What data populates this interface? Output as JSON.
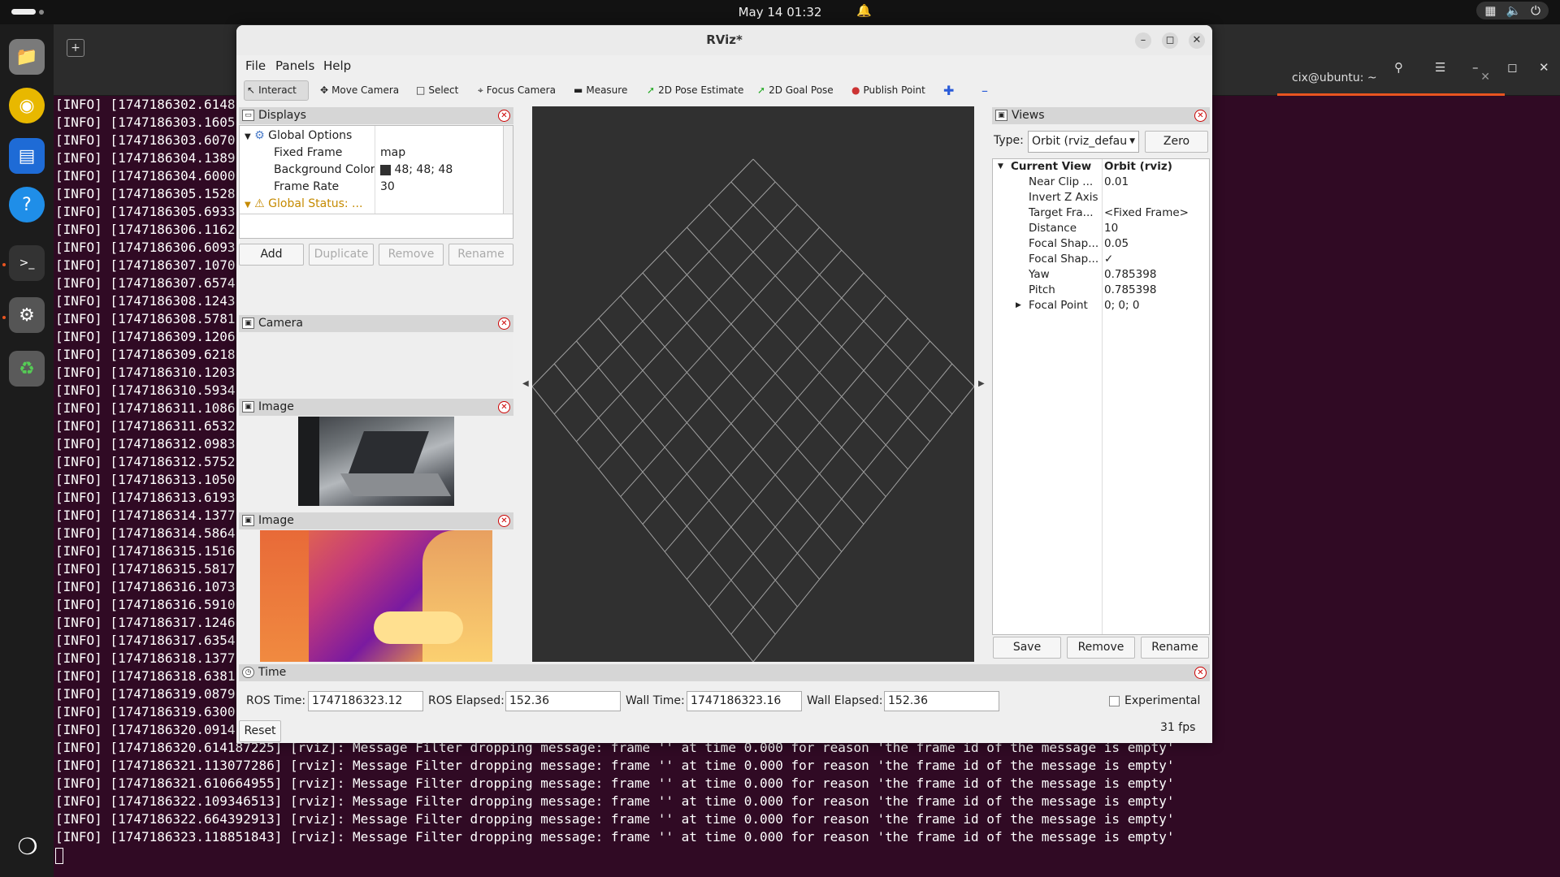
{
  "desktop": {
    "clock": "May 14  01:32"
  },
  "terminal": {
    "tab_title": "cix@ubuntu: ~",
    "lines": [
      "[INFO] [1747186302.6148",
      "[INFO] [1747186303.1605",
      "[INFO] [1747186303.6070",
      "[INFO] [1747186304.1389",
      "[INFO] [1747186304.6000",
      "[INFO] [1747186305.1528",
      "[INFO] [1747186305.6933",
      "[INFO] [1747186306.1162",
      "[INFO] [1747186306.6093",
      "[INFO] [1747186307.1070",
      "[INFO] [1747186307.6574",
      "[INFO] [1747186308.1243",
      "[INFO] [1747186308.5781",
      "[INFO] [1747186309.1206",
      "[INFO] [1747186309.6218",
      "[INFO] [1747186310.1203",
      "[INFO] [1747186310.5934",
      "[INFO] [1747186311.1086",
      "[INFO] [1747186311.6532",
      "[INFO] [1747186312.0983",
      "[INFO] [1747186312.5752",
      "[INFO] [1747186313.1050",
      "[INFO] [1747186313.6193",
      "[INFO] [1747186314.1377",
      "[INFO] [1747186314.5864",
      "[INFO] [1747186315.1516",
      "[INFO] [1747186315.5817",
      "[INFO] [1747186316.1073",
      "[INFO] [1747186316.5910",
      "[INFO] [1747186317.1246",
      "[INFO] [1747186317.6354",
      "[INFO] [1747186318.1377",
      "[INFO] [1747186318.6381",
      "[INFO] [1747186319.0879",
      "[INFO] [1747186319.6300",
      "[INFO] [1747186320.0914",
      "[INFO] [1747186320.614187225] [rviz]: Message Filter dropping message: frame '' at time 0.000 for reason 'the frame id of the message is empty'",
      "[INFO] [1747186321.113077286] [rviz]: Message Filter dropping message: frame '' at time 0.000 for reason 'the frame id of the message is empty'",
      "[INFO] [1747186321.610664955] [rviz]: Message Filter dropping message: frame '' at time 0.000 for reason 'the frame id of the message is empty'",
      "[INFO] [1747186322.109346513] [rviz]: Message Filter dropping message: frame '' at time 0.000 for reason 'the frame id of the message is empty'",
      "[INFO] [1747186322.664392913] [rviz]: Message Filter dropping message: frame '' at time 0.000 for reason 'the frame id of the message is empty'",
      "[INFO] [1747186323.118851843] [rviz]: Message Filter dropping message: frame '' at time 0.000 for reason 'the frame id of the message is empty'"
    ]
  },
  "rviz": {
    "title": "RViz*",
    "menu": {
      "file": "File",
      "panels": "Panels",
      "help": "Help"
    },
    "toolbar": {
      "interact": "Interact",
      "move_camera": "Move Camera",
      "select": "Select",
      "focus_camera": "Focus Camera",
      "measure": "Measure",
      "pose_estimate": "2D Pose Estimate",
      "goal_pose": "2D Goal Pose",
      "publish_point": "Publish Point"
    },
    "displays": {
      "title": "Displays",
      "global_options": "Global Options",
      "fixed_frame_k": "Fixed Frame",
      "fixed_frame_v": "map",
      "bg_color_k": "Background Color",
      "bg_color_v": "48; 48; 48",
      "frame_rate_k": "Frame Rate",
      "frame_rate_v": "30",
      "global_status": "Global Status: ...",
      "add": "Add",
      "duplicate": "Duplicate",
      "remove": "Remove",
      "rename": "Rename"
    },
    "camera": {
      "title": "Camera"
    },
    "image1": {
      "title": "Image"
    },
    "image2": {
      "title": "Image"
    },
    "views": {
      "title": "Views",
      "type_label": "Type:",
      "type_value": "Orbit (rviz_defau",
      "zero": "Zero",
      "current_view": "Current View",
      "current_view_v": "Orbit (rviz)",
      "props": [
        {
          "k": "Near Clip ...",
          "v": "0.01"
        },
        {
          "k": "Invert Z Axis",
          "v": ""
        },
        {
          "k": "Target Fra...",
          "v": "<Fixed Frame>"
        },
        {
          "k": "Distance",
          "v": "10"
        },
        {
          "k": "Focal Shap...",
          "v": "0.05"
        },
        {
          "k": "Focal Shap...",
          "v": "✓"
        },
        {
          "k": "Yaw",
          "v": "0.785398"
        },
        {
          "k": "Pitch",
          "v": "0.785398"
        },
        {
          "k": "Focal Point",
          "v": "0; 0; 0"
        }
      ],
      "save": "Save",
      "remove": "Remove",
      "rename": "Rename"
    },
    "time": {
      "title": "Time",
      "ros_time_label": "ROS Time:",
      "ros_time": "1747186323.12",
      "ros_elapsed_label": "ROS Elapsed:",
      "ros_elapsed": "152.36",
      "wall_time_label": "Wall Time:",
      "wall_time": "1747186323.16",
      "wall_elapsed_label": "Wall Elapsed:",
      "wall_elapsed": "152.36",
      "experimental": "Experimental",
      "reset": "Reset",
      "fps": "31 fps"
    }
  }
}
